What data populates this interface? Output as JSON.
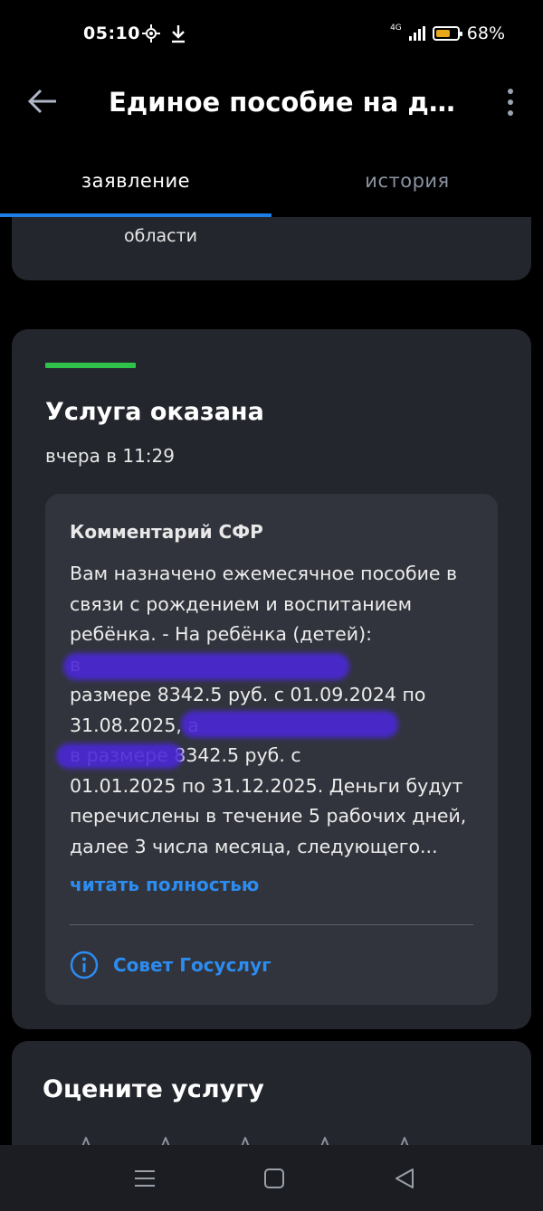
{
  "status_bar": {
    "time": "05:10",
    "icons": [
      "settings-icon",
      "download-icon",
      "signal-icon",
      "battery-icon"
    ],
    "network": "4G",
    "battery": "68%",
    "battery_level": 0.68,
    "battery_color": "#e9a71b"
  },
  "app_bar": {
    "title": "Единое пособие на детей",
    "back_icon": "arrow-left-icon",
    "menu_icon": "more-vertical-icon"
  },
  "tabs": [
    {
      "label": "заявление",
      "active": true
    },
    {
      "label": "история",
      "active": false
    }
  ],
  "partial_card": {
    "address_tail": "области"
  },
  "service": {
    "status": "Услуга оказана",
    "status_color": "#2ec24a",
    "time": "вчера в 11:29",
    "comment": {
      "title": "Комментарий СФР",
      "text": "Вам назначено ежемесячное пособие в связи с рождением и воспитанием ребёнка. - На ребёнка (детей):\n                                             в\nразмере 8342.5 руб. с 01.09.2024 по\n31.08.2025,                                     а\n                     в размере 8342.5 руб. с\n01.01.2025 по 31.12.2025. Деньги будут перечислены в течение 5 рабочих дней, далее 3 числа месяца, следующего...",
      "read_more": "читать полностью",
      "advice": "Совет Госуслуг"
    }
  },
  "rating": {
    "title": "Оцените услугу",
    "stars": 5
  },
  "nav_bar": {
    "buttons": [
      "menu-icon",
      "home-icon",
      "back-icon"
    ]
  },
  "colors": {
    "accent": "#2d8cf0",
    "tab_indicator": "#1e7ee8",
    "card_bg": "#23262d",
    "comment_bg": "#31343c"
  }
}
